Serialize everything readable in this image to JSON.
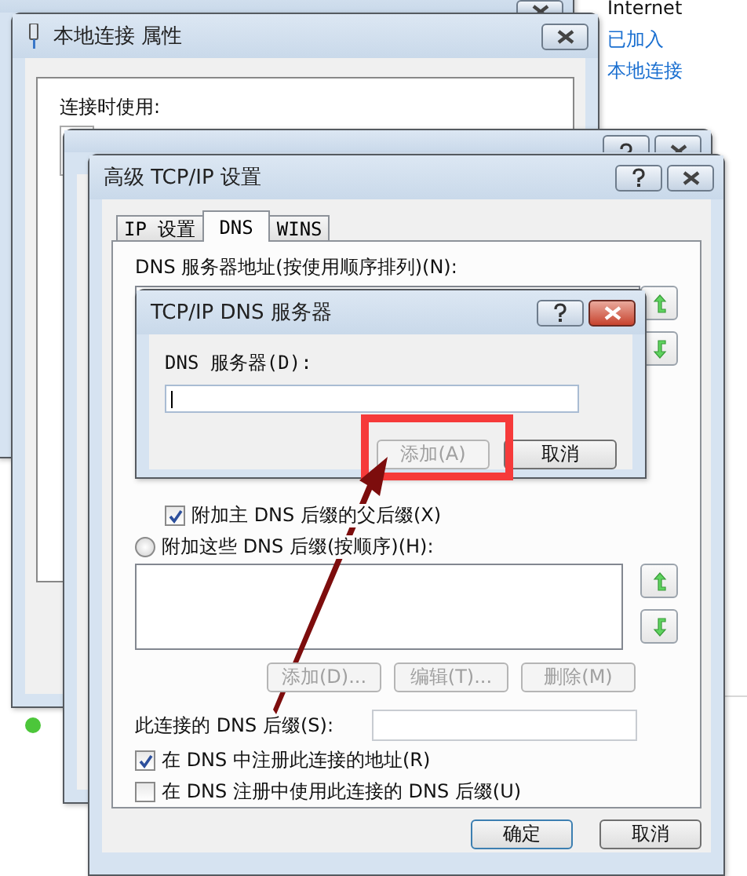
{
  "side_panel": {
    "items": [
      {
        "text": "Internet",
        "kind": "text"
      },
      {
        "text": "已加入",
        "kind": "link"
      },
      {
        "text": "本地连接",
        "kind": "link"
      }
    ]
  },
  "properties_window": {
    "title": "本地连接 属性",
    "connect_using_label": "连接时使用:"
  },
  "advanced_window": {
    "title": "高级 TCP/IP 设置",
    "tabs": [
      {
        "label": "IP 设置",
        "selected": false
      },
      {
        "label": "DNS",
        "selected": true
      },
      {
        "label": "WINS",
        "selected": false
      }
    ],
    "dns_servers_label": "DNS 服务器地址(按使用顺序排列)(N):",
    "append_parent": {
      "label": "附加主 DNS 后缀的父后缀(X)",
      "checked": true
    },
    "append_these": {
      "label": "附加这些 DNS 后缀(按顺序)(H):",
      "selected": false
    },
    "suffix_buttons": [
      {
        "label": "添加(D)...",
        "disabled": true
      },
      {
        "label": "编辑(T)...",
        "disabled": true
      },
      {
        "label": "删除(M)",
        "disabled": true
      }
    ],
    "suffix_label": "此连接的 DNS 后缀(S):",
    "checkboxes": [
      {
        "label": "在 DNS 中注册此连接的地址(R)",
        "checked": true
      },
      {
        "label": "在 DNS 注册中使用此连接的 DNS 后缀(U)",
        "checked": false
      }
    ],
    "buttons": [
      {
        "label": "确定"
      },
      {
        "label": "取消"
      }
    ]
  },
  "dns_dialog": {
    "title": "TCP/IP DNS 服务器",
    "field_label": "DNS 服务器(D):",
    "buttons": [
      {
        "label": "添加(A)",
        "disabled": true
      },
      {
        "label": "取消",
        "disabled": false
      }
    ]
  }
}
